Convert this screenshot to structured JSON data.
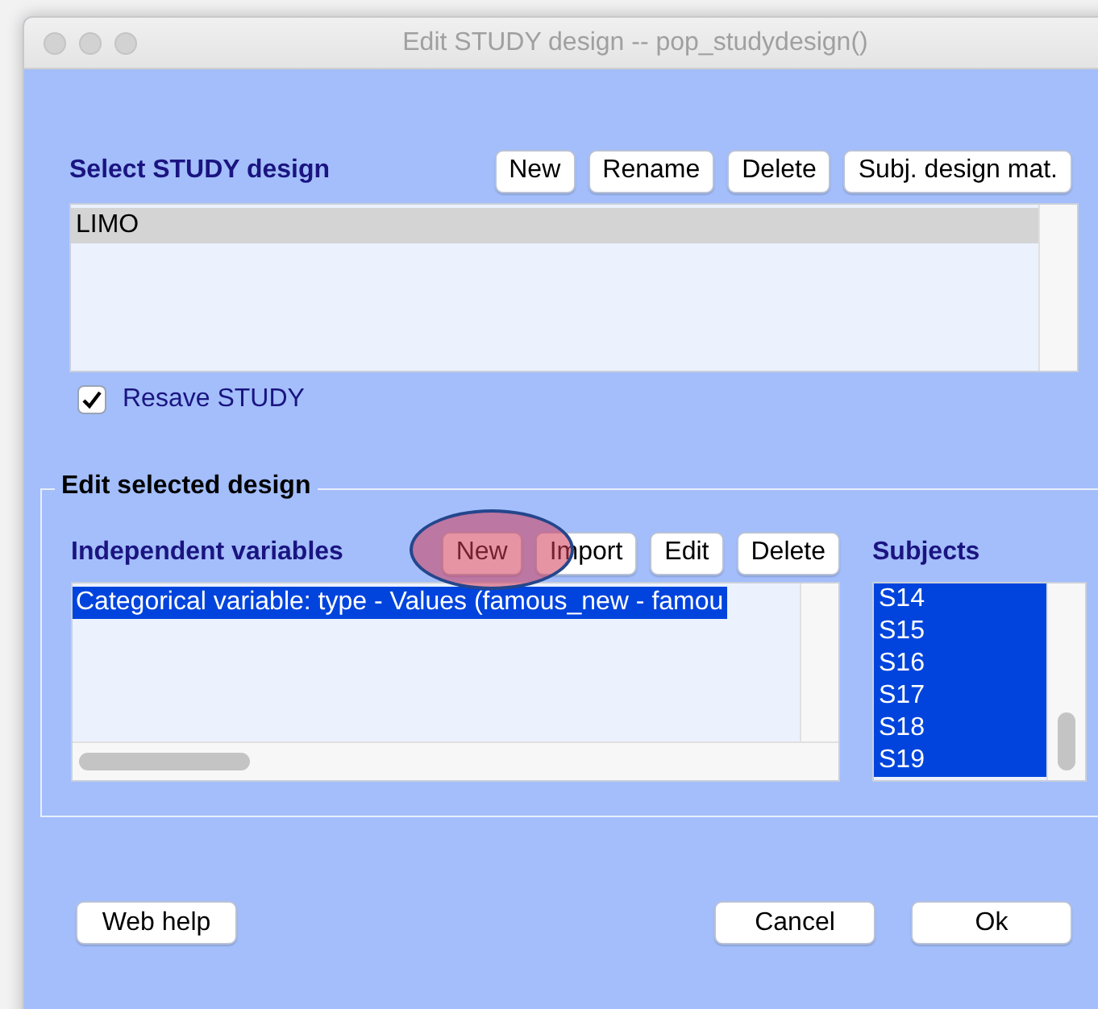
{
  "window": {
    "title": "Edit STUDY design -- pop_studydesign()"
  },
  "study_design": {
    "label": "Select STUDY design",
    "buttons": [
      "New",
      "Rename",
      "Delete",
      "Subj. design mat."
    ],
    "list": [
      {
        "label": "LIMO",
        "selected": true
      }
    ],
    "resave": {
      "label": "Resave STUDY",
      "checked": true
    }
  },
  "edit_design": {
    "title": "Edit selected design",
    "variables_label": "Independent variables",
    "buttons": [
      {
        "label": "New",
        "highlighted": true
      },
      {
        "label": "Import",
        "highlighted": false
      },
      {
        "label": "Edit",
        "highlighted": false
      },
      {
        "label": "Delete",
        "highlighted": false
      }
    ],
    "variables": [
      {
        "label": "Categorical variable: type - Values (famous_new - famou",
        "selected": true
      }
    ],
    "subjects_label": "Subjects",
    "subjects": [
      {
        "label": "S14",
        "selected": true
      },
      {
        "label": "S15",
        "selected": true
      },
      {
        "label": "S16",
        "selected": true
      },
      {
        "label": "S17",
        "selected": true
      },
      {
        "label": "S18",
        "selected": true
      },
      {
        "label": "S19",
        "selected": true
      }
    ]
  },
  "footer": {
    "help_button": "Web help",
    "buttons": [
      "Cancel",
      "Ok"
    ]
  }
}
